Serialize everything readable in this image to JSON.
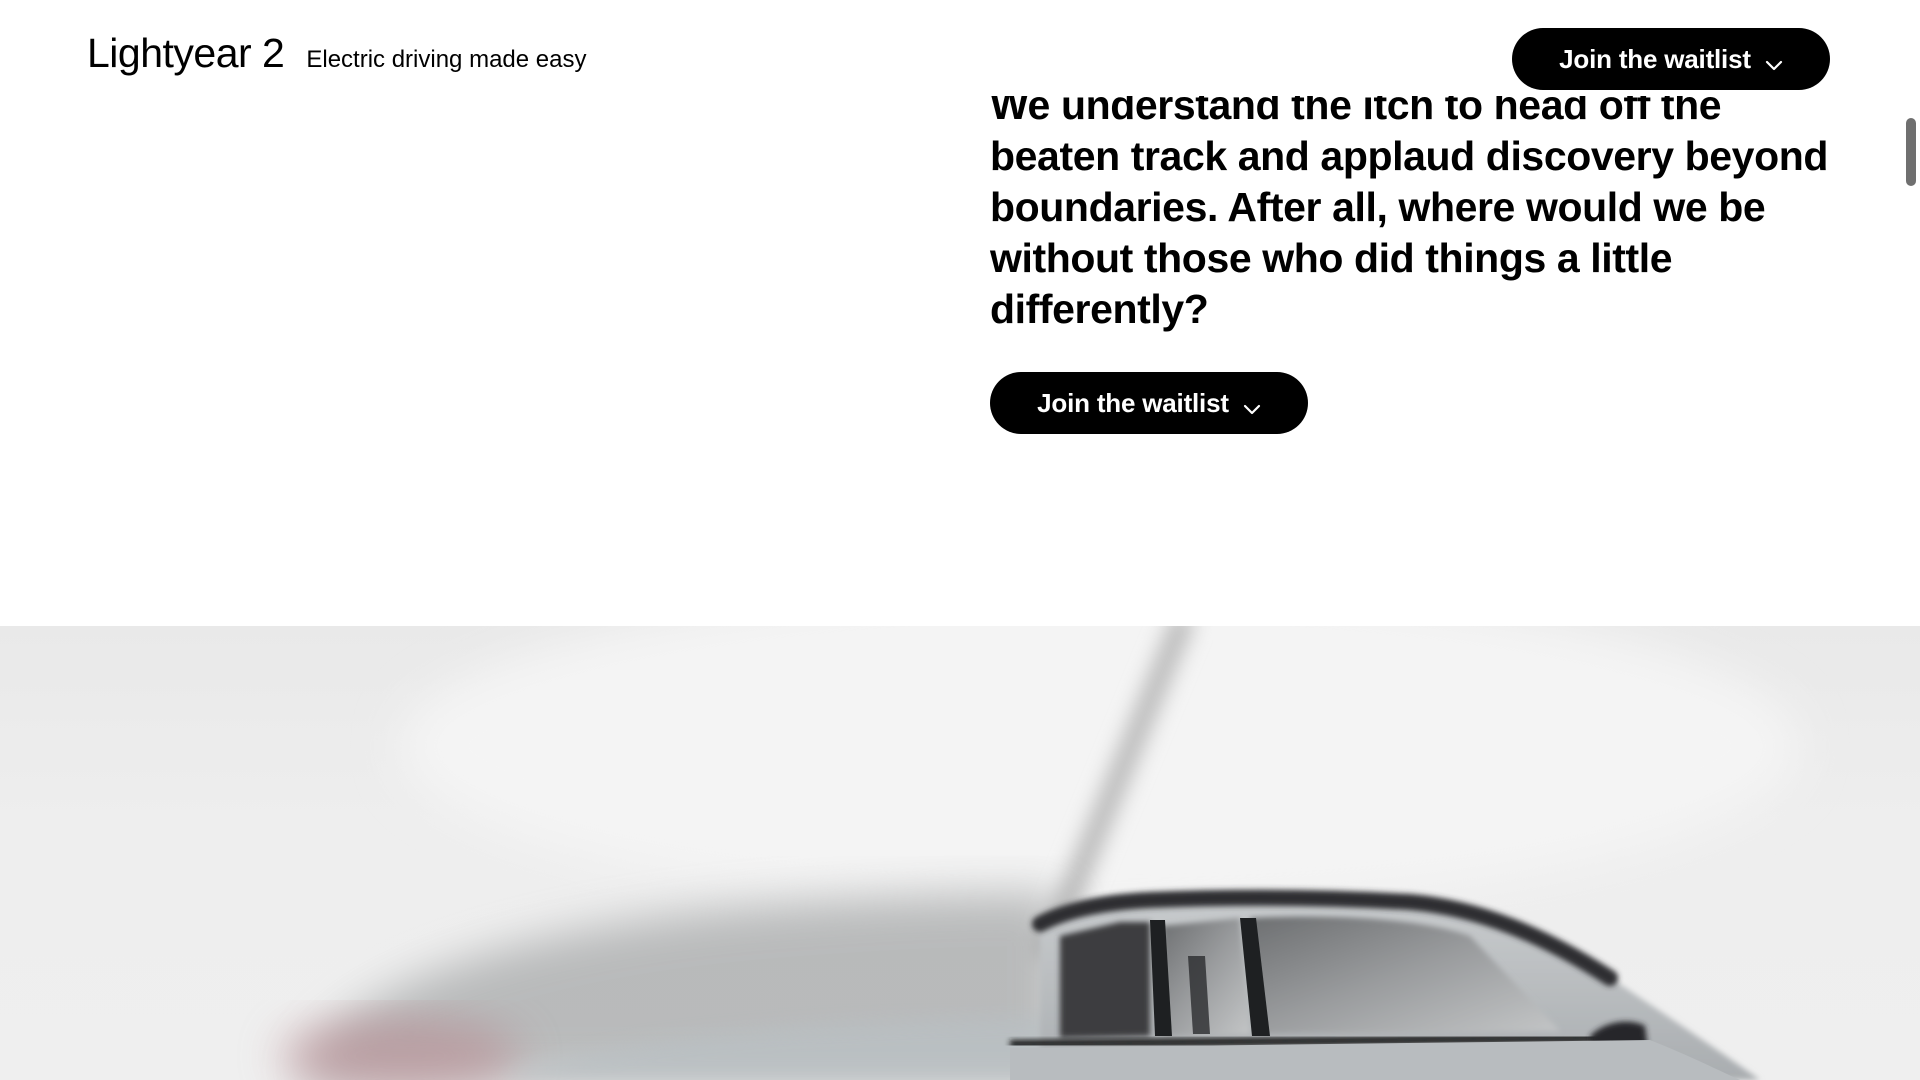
{
  "header": {
    "brand_name": "Lightyear 2",
    "tagline": "Electric driving made easy",
    "cta_label": "Join the waitlist",
    "cta_icon": "chevron-down-icon"
  },
  "main": {
    "statement": "We understand the itch to head off the beaten track and applaud discovery beyond boundaries. After all, where would we be without those who did things a little differently?",
    "cta_label": "Join the waitlist",
    "cta_icon": "chevron-down-icon"
  },
  "hero": {
    "image_subject": "car"
  },
  "colors": {
    "button_bg": "#000000",
    "button_text": "#ffffff",
    "page_bg": "#ffffff",
    "hero_bg": "#ececec"
  }
}
